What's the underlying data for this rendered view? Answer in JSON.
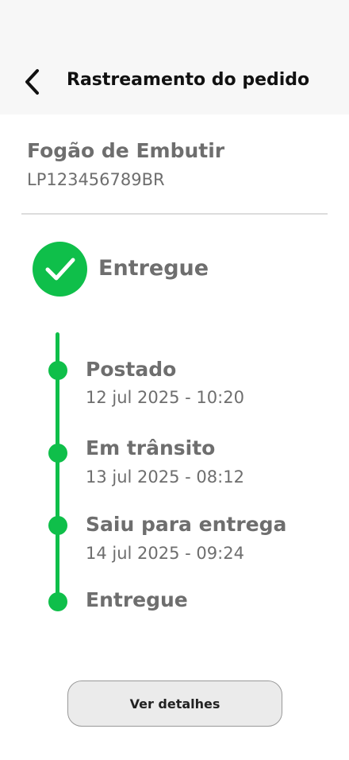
{
  "header": {
    "title": "Rastreamento do pedido",
    "back_icon": "chevron-left-icon"
  },
  "order": {
    "product_name": "Fogão de Embutir",
    "tracking_code": "LP123456789BR"
  },
  "status": {
    "label": "Entregue",
    "icon": "check-circle-icon"
  },
  "timeline": [
    {
      "title": "Postado",
      "date": "12 jul 2025 - 10:20"
    },
    {
      "title": "Em trânsito",
      "date": "13 jul 2025 - 08:12"
    },
    {
      "title": "Saiu para entrega",
      "date": "14 jul 2025 - 09:24"
    },
    {
      "title": "Entregue",
      "date": ""
    }
  ],
  "actions": {
    "details_label": "Ver detalhes"
  },
  "colors": {
    "accent": "#0fbf4a",
    "text_muted": "#6e6e6e",
    "header_bg": "#f7f7f7"
  }
}
